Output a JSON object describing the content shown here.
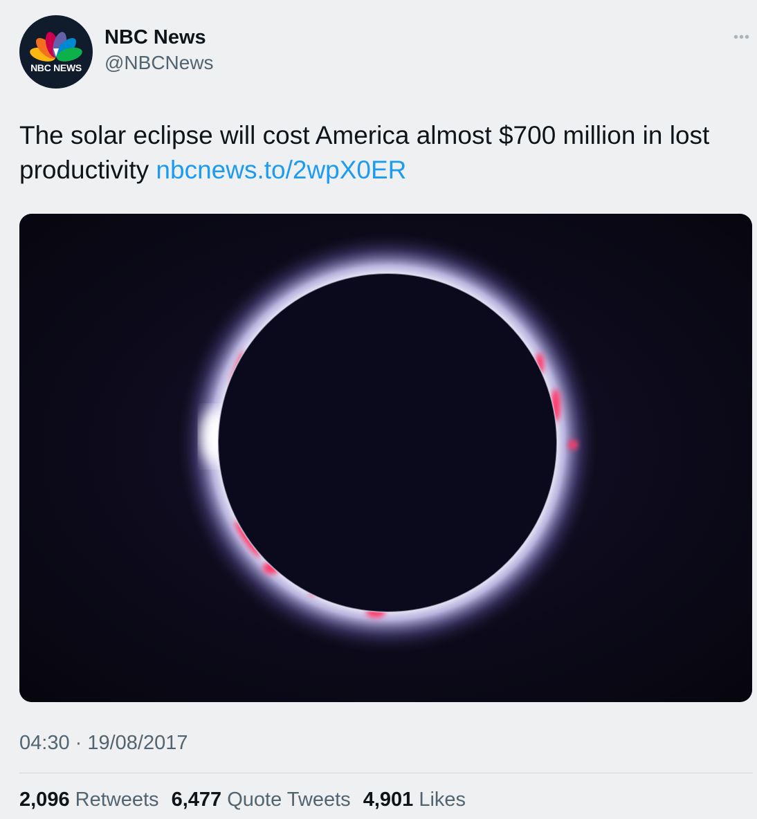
{
  "author": {
    "avatar_text": "NBC NEWS",
    "display_name": "NBC News",
    "handle": "@NBCNews"
  },
  "tweet": {
    "text": "The solar eclipse will cost America almost $700 million in lost productivity ",
    "link": "nbcnews.to/2wpX0ER",
    "timestamp": "04:30 · 19/08/2017"
  },
  "stats": {
    "retweets": {
      "count": "2,096",
      "label": "Retweets"
    },
    "quotes": {
      "count": "6,477",
      "label": "Quote Tweets"
    },
    "likes": {
      "count": "4,901",
      "label": "Likes"
    }
  },
  "icons": {
    "more": "more-horizontal-icon",
    "logo": "nbc-peacock-logo"
  },
  "colors": {
    "link": "#1d9bf0",
    "secondary_text": "#536471",
    "background": "#eef0f2"
  }
}
